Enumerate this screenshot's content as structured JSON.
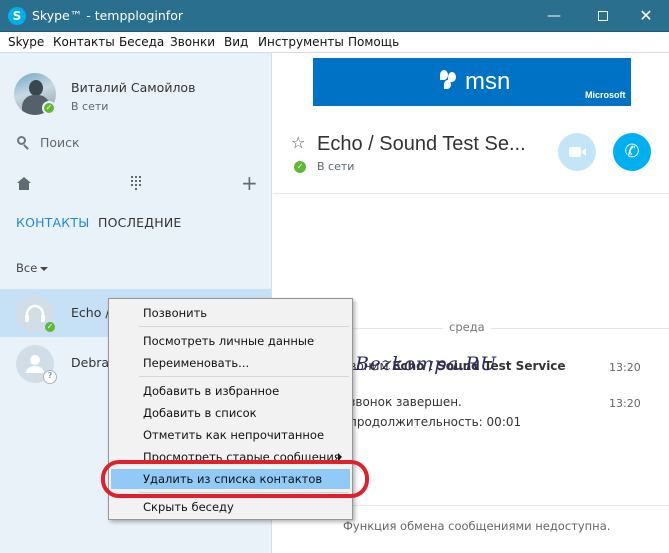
{
  "window": {
    "title": "Skype™ - tempploginfor"
  },
  "menubar": [
    "Skype",
    "Контакты",
    "Беседа",
    "Звонки",
    "Вид",
    "Инструменты",
    "Помощь"
  ],
  "profile": {
    "name": "Виталий Самойлов",
    "status": "В сети"
  },
  "search": {
    "label": "Поиск"
  },
  "tabs": {
    "contacts": "КОНТАКТЫ",
    "recent": "ПОСЛЕДНИЕ"
  },
  "filter": {
    "label": "Все"
  },
  "contacts": [
    {
      "name": "Echo /",
      "status": "online",
      "selected": true
    },
    {
      "name": "Debra",
      "status": "unknown",
      "selected": false
    }
  ],
  "context_menu": {
    "items": [
      "Позвонить",
      "Посмотреть личные данные",
      "Переименовать...",
      "Добавить в избранное",
      "Добавить в список",
      "Отметить как непрочитанное",
      "Просмотреть старые сообщения",
      "Удалить из списка контактов",
      "Скрыть беседу"
    ],
    "highlighted": "Удалить из списка контактов"
  },
  "banner": {
    "brand": "msn",
    "company": "Microsoft"
  },
  "conversation": {
    "title": "Echo / Sound Test Se...",
    "status": "В сети",
    "day": "среда",
    "messages": {
      "m1_prefix": "звоним ",
      "m1_bold": "Echo / Sound Test Service",
      "m1_time": "13:20",
      "m2": "звонок завершен.",
      "m2_time": "13:20",
      "m3": "продолжительность: 00:01"
    },
    "footer": "Функция обмена сообщениями недоступна."
  },
  "watermark": "Bezkompa.RU",
  "colors": {
    "titlebar": "#2b6f8e",
    "accent": "#00aff0",
    "highlight": "#91c9f7",
    "annotation": "#e0202a"
  }
}
